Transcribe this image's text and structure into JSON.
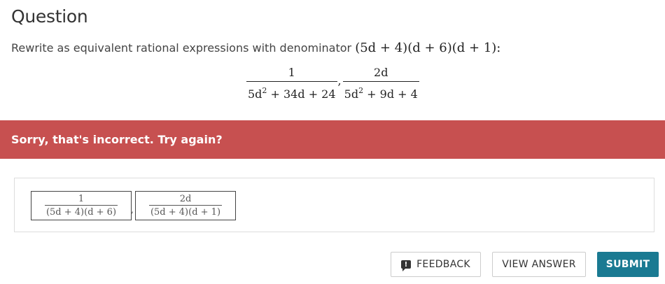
{
  "header": {
    "title": "Question"
  },
  "question": {
    "prompt_text": "Rewrite as equivalent rational expressions with denominator",
    "denominator_expr": "(5d + 4)(d + 6)(d + 1):",
    "fractions": [
      {
        "numerator": "1",
        "denominator_base": "5d",
        "denominator_exp": "2",
        "denominator_rest": " + 34d + 24"
      },
      {
        "numerator": "2d",
        "denominator_base": "5d",
        "denominator_exp": "2",
        "denominator_rest": " + 9d + 4"
      }
    ],
    "separator": ","
  },
  "feedback_banner": {
    "text": "Sorry, that's incorrect. Try again?",
    "color": "#c75050"
  },
  "answers": [
    {
      "numerator": "1",
      "denominator": "(5d + 4)(d + 6)"
    },
    {
      "numerator": "2d",
      "denominator": "(5d + 4)(d + 1)"
    }
  ],
  "answer_separator": ",",
  "buttons": {
    "feedback_label": "FEEDBACK",
    "feedback_icon": "feedback-exclamation-icon",
    "view_answer_label": "VIEW ANSWER",
    "submit_label": "SUBMIT",
    "submit_color": "#1a7a92"
  }
}
